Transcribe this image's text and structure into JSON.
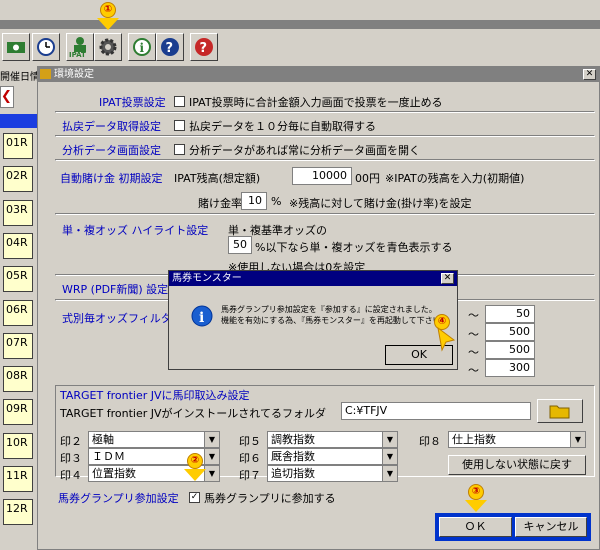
{
  "window": {
    "title": "環境設定",
    "left_tab": "開催日情"
  },
  "left_races": [
    "01R",
    "02R",
    "03R",
    "04R",
    "05R",
    "06R",
    "07R",
    "08R",
    "09R",
    "10R",
    "11R",
    "12R"
  ],
  "settings": {
    "ipat_vote": {
      "label": "IPAT投票設定",
      "checkbox": "IPAT投票時に合計金額入力画面で投票を一度止める"
    },
    "payout": {
      "label": "払戻データ取得設定",
      "checkbox": "払戻データを１０分毎に自動取得する"
    },
    "analysis": {
      "label": "分析データ画面設定",
      "checkbox": "分析データがあれば常に分析データ画面を開く"
    },
    "auto_bet": {
      "label": "自動賭け金 初期設定",
      "balance_label": "IPAT残高(想定額)",
      "balance_value": "10000",
      "balance_unit": "00円",
      "note": "※IPATの残高を入力(初期値)",
      "rate_label": "賭け金率",
      "rate_value": "10",
      "rate_unit": "%",
      "rate_note": "※残高に対して賭け金(掛け率)を設定"
    },
    "odds_highlight": {
      "label": "単・複オッズ ハイライト設定",
      "line1": "単・複基準オッズの",
      "value": "50",
      "line2": "%以下なら単・複オッズを青色表示する",
      "note": "※使用しない場合は0を設定"
    },
    "wrp": {
      "label": "WRP (PDF新聞) 設定"
    },
    "odds_filter": {
      "label": "式別毎オッズフィルタ",
      "values": [
        "50",
        "500",
        "500",
        "300"
      ],
      "tilde": "～"
    },
    "target": {
      "group_label": "TARGET frontier JVに馬印取込み設定",
      "folder_label": "TARGET frontier JVがインストールされてるフォルダ",
      "folder_value": "C:¥TFJV",
      "marks": [
        {
          "label": "印２",
          "value": "極軸"
        },
        {
          "label": "印３",
          "value": "ＩＤＭ"
        },
        {
          "label": "印４",
          "value": "位置指数"
        },
        {
          "label": "印５",
          "value": "調教指数"
        },
        {
          "label": "印６",
          "value": "厩舎指数"
        },
        {
          "label": "印７",
          "value": "追切指数"
        },
        {
          "label": "印８",
          "value": "仕上指数"
        }
      ],
      "reset_button": "使用しない状態に戻す"
    },
    "grand_prix": {
      "label": "馬券グランプリ参加設定",
      "checkbox": "馬券グランプリに参加する",
      "checked_mark": "✓"
    }
  },
  "buttons": {
    "ok": "ＯＫ",
    "cancel": "キャンセル"
  },
  "dialog": {
    "title": "馬券モンスター",
    "line1": "馬券グランプリ参加設定を『参加する』に設定されました。",
    "line2": "機能を有効にする為、『馬券モンスター』を再起動して下さい。",
    "ok": "OK"
  },
  "markers": {
    "m1": "①",
    "m2": "②",
    "m3": "③",
    "m4": "④"
  },
  "colors": {
    "accent_blue": "#0000c0",
    "dialog_title": "#000080",
    "marker": "#ffcc00"
  }
}
